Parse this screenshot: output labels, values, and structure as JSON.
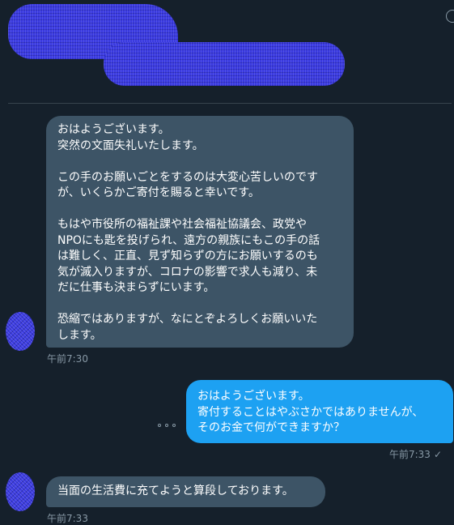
{
  "conversation": {
    "messages": [
      {
        "direction": "incoming",
        "paragraphs": [
          "おはようございます。\n突然の文面失礼いたします。",
          "この手のお願いごとをするのは大変心苦しいのです\nが、いくらかご寄付を賜ると幸いです。",
          "もはや市役所の福祉課や社会福祉協議会、政党や\nNPOにも匙を投げられ、遠方の親族にもこの手の話\nは難しく、正直、見ず知らずの方にお願いするのも\n気が滅入りますが、コロナの影響で求人も減り、未\nだに仕事も決まらずにいます。",
          "恐縮ではありますが、なにとぞよろしくお願いいた\nします。"
        ],
        "time": "午前7:30"
      },
      {
        "direction": "outgoing",
        "paragraphs": [
          "おはようございます。\n寄付することはやぶさかではありませんが、\nそのお金で何ができますか？"
        ],
        "time": "午前7:33",
        "read_mark": "✓"
      },
      {
        "direction": "incoming",
        "paragraphs": [
          "当面の生活費に充てようと算段しております。"
        ],
        "time": "午前7:33"
      }
    ]
  },
  "colors": {
    "background": "#15202b",
    "incoming_bubble": "#3d5466",
    "outgoing_bubble": "#1da1f2",
    "timestamp": "#8899a6",
    "redaction": "#3a3ae0"
  },
  "icons": {
    "header": "info-icon",
    "message_actions": "more-options-icon"
  }
}
